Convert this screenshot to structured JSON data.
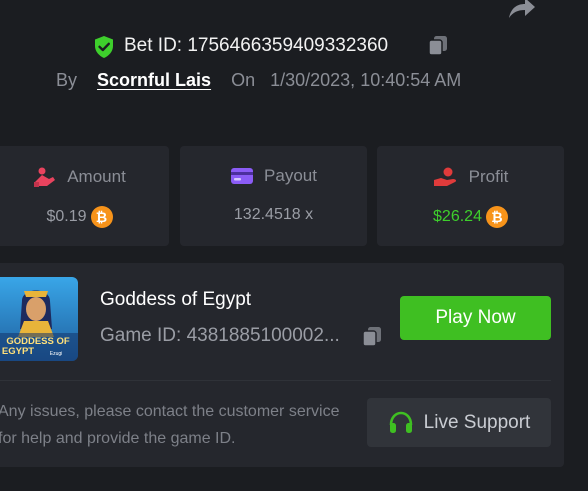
{
  "bet": {
    "id_label": "Bet ID: 1756466359409332360",
    "by_label": "By",
    "user": "Scornful Lais",
    "on_label": "On",
    "datetime": "1/30/2023, 10:40:54 AM"
  },
  "stats": {
    "amount": {
      "label": "Amount",
      "value": "$0.19",
      "currency_icon": "bitcoin-icon"
    },
    "payout": {
      "label": "Payout",
      "value": "132.4518 x"
    },
    "profit": {
      "label": "Profit",
      "value": "$26.24",
      "currency_icon": "bitcoin-icon"
    }
  },
  "game": {
    "title": "Goddess of Egypt",
    "id_label": "Game ID: 4381885100002...",
    "thumb_title_line1": "GODDESS OF",
    "thumb_title_line2": "EGYPT",
    "thumb_brand": "Ezugi"
  },
  "buttons": {
    "play": "Play Now",
    "support": "Live Support"
  },
  "notice": "Any issues, please contact the customer service for help and provide the game ID.",
  "colors": {
    "background": "#1b1d21",
    "card": "#25272d",
    "accent_green": "#3fbf22",
    "profit_green": "#3ecf2c",
    "bitcoin": "#f7931a",
    "amount_icon": "#e8435e",
    "payout_icon": "#8b5cf6",
    "profit_icon": "#e03b3b"
  }
}
